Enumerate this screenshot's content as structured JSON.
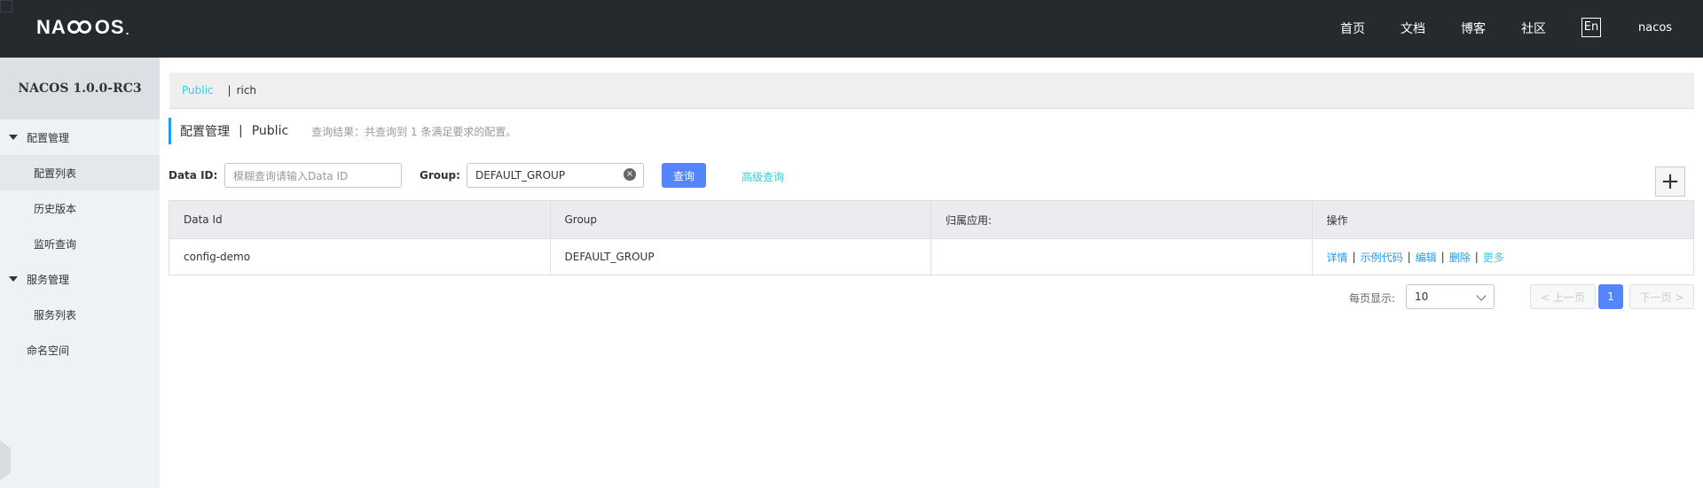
{
  "app": {
    "logo_left": "NA",
    "logo_right": "OS",
    "logo_dot": "."
  },
  "topnav": {
    "items": [
      "首页",
      "文档",
      "博客",
      "社区"
    ],
    "lang": "En",
    "user": "nacos"
  },
  "sidebar": {
    "title": "NACOS 1.0.0-RC3",
    "groups": [
      {
        "label": "配置管理",
        "items": [
          "配置列表",
          "历史版本",
          "监听查询"
        ]
      },
      {
        "label": "服务管理",
        "items": [
          "服务列表"
        ]
      }
    ],
    "namespace": "命名空间"
  },
  "namespace_bar": {
    "active": "Public",
    "separator": "|",
    "other": "rich"
  },
  "page_header": {
    "title": "配置管理",
    "separator": "|",
    "namespace": "Public",
    "result": "查询结果：共查询到 1 条满足要求的配置。"
  },
  "filters": {
    "data_id_label": "Data ID:",
    "data_id_placeholder": "模糊查询请输入Data ID",
    "group_label": "Group:",
    "group_value": "DEFAULT_GROUP",
    "search_button": "查询",
    "advanced_link": "高级查询",
    "add_button": "+"
  },
  "table": {
    "headers": [
      "Data Id",
      "Group",
      "归属应用:",
      "操作"
    ],
    "rows": [
      {
        "data_id": "config-demo",
        "group": "DEFAULT_GROUP",
        "app": ""
      }
    ],
    "ops": [
      "详情",
      "示例代码",
      "编辑",
      "删除",
      "更多"
    ],
    "op_separator": "|"
  },
  "pagination": {
    "page_size_label": "每页显示:",
    "page_size": "10",
    "prev": "< 上一页",
    "current": "1",
    "next": "下一页 >"
  }
}
